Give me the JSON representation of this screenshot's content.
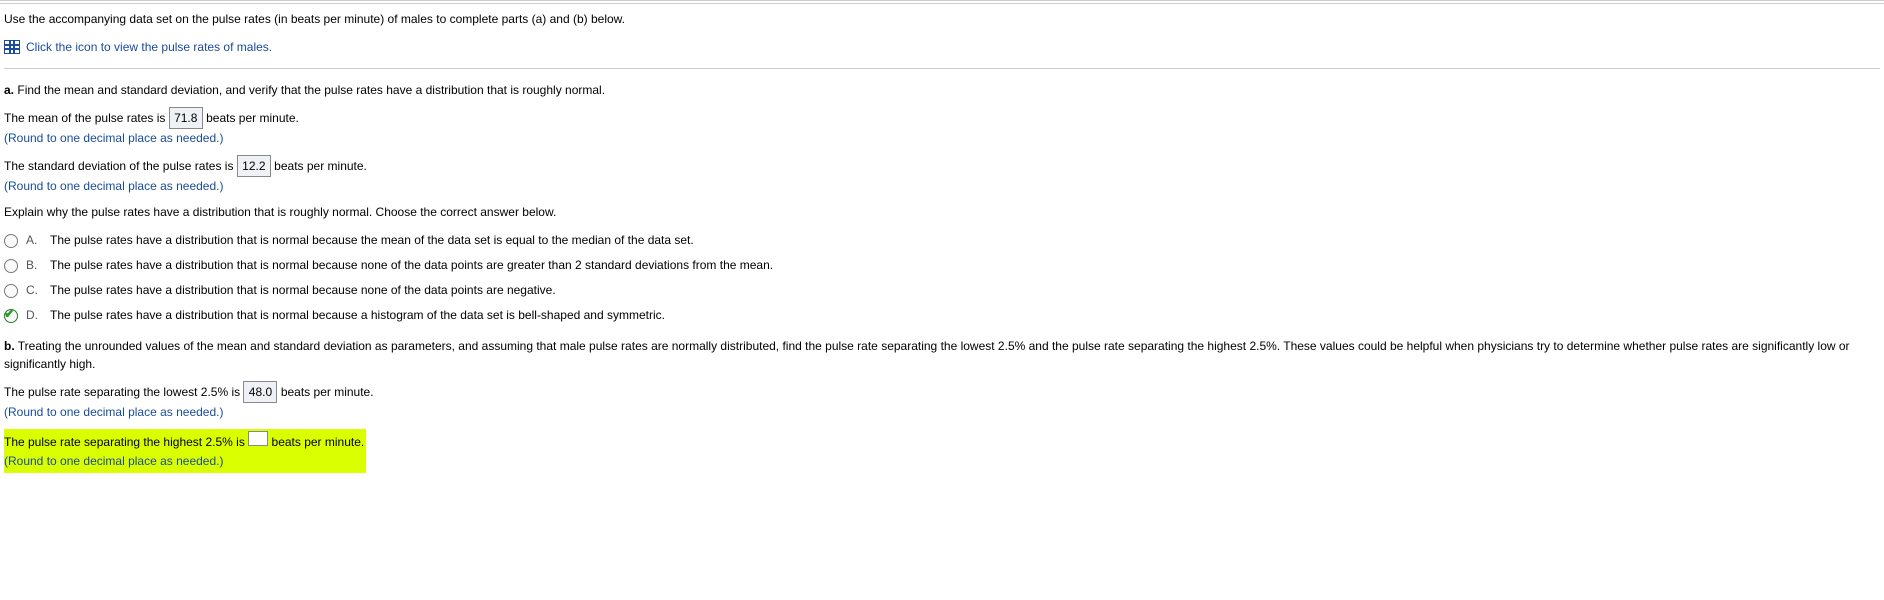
{
  "intro": "Use the accompanying data set on the pulse rates (in beats per minute) of males to complete parts (a) and (b) below.",
  "link": {
    "text": "Click the icon to view the pulse rates of males."
  },
  "partA": {
    "prefix": "a.",
    "prompt": "Find the mean and standard deviation, and verify that the pulse rates have a distribution that is roughly normal.",
    "mean": {
      "pre": "The mean of the pulse rates is",
      "value": "71.8",
      "post": "beats per minute."
    },
    "std": {
      "pre": "The standard deviation of the pulse rates is",
      "value": "12.2",
      "post": "beats per minute."
    },
    "hint": "(Round to one decimal place as needed.)",
    "explain": "Explain why the pulse rates have a distribution that is roughly normal. Choose the correct answer below.",
    "options": {
      "A": "The pulse rates have a distribution that is normal because the mean of the data set is equal to the median of the data set.",
      "B": "The pulse rates have a distribution that is normal because none of the data points are greater than 2 standard deviations from the mean.",
      "C": "The pulse rates have a distribution that is normal because none of the data points are negative.",
      "D": "The pulse rates have a distribution that is normal because a histogram of the data set is bell-shaped and symmetric."
    }
  },
  "partB": {
    "prefix": "b.",
    "prompt": "Treating the unrounded values of the mean and standard deviation as parameters, and assuming that male pulse rates are normally distributed, find the pulse rate separating the lowest 2.5% and the pulse rate separating the highest 2.5%. These values could be helpful when physicians try to determine whether pulse rates are significantly low or significantly high.",
    "low": {
      "pre": "The pulse rate separating the lowest 2.5% is",
      "value": "48.0",
      "post": "beats per minute."
    },
    "high": {
      "pre": "The pulse rate separating the highest 2.5% is",
      "value": "",
      "post": "beats per minute."
    },
    "hint": "(Round to one decimal place as needed.)"
  },
  "letters": {
    "A": "A.",
    "B": "B.",
    "C": "C.",
    "D": "D."
  }
}
